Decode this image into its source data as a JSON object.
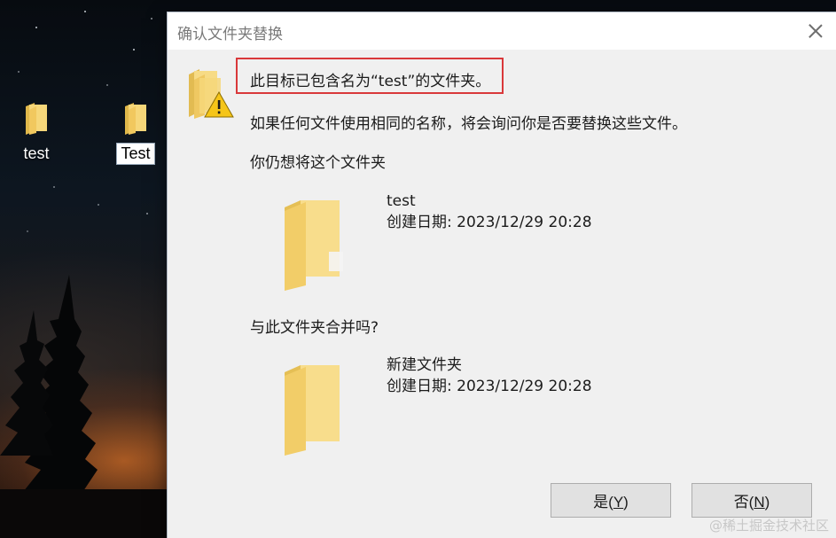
{
  "desktop": {
    "icons": [
      {
        "label": "test",
        "icon": "folder-icon",
        "selected": false
      },
      {
        "label": "Test",
        "icon": "folder-icon",
        "selected": true
      }
    ]
  },
  "dialog": {
    "title": "确认文件夹替换",
    "close_icon": "close-icon",
    "warning_icon": "warning-folder-icon",
    "message_heading": "此目标已包含名为“test”的文件夹。",
    "message_body": "如果任何文件使用相同的名称，将会询问你是否要替换这些文件。",
    "still_want": "你仍想将这个文件夹",
    "existing_folder": {
      "name": "test",
      "created": "创建日期: 2023/12/29 20:28"
    },
    "merge_question": "与此文件夹合并吗?",
    "new_folder": {
      "name": "新建文件夹",
      "created": "创建日期: 2023/12/29 20:28"
    },
    "buttons": {
      "yes": {
        "label": "是(",
        "hotkey": "Y",
        "suffix": ")"
      },
      "no": {
        "label": "否(",
        "hotkey": "N",
        "suffix": ")"
      }
    },
    "highlight_color": "#d9383a"
  },
  "watermark": "@稀土掘金技术社区"
}
